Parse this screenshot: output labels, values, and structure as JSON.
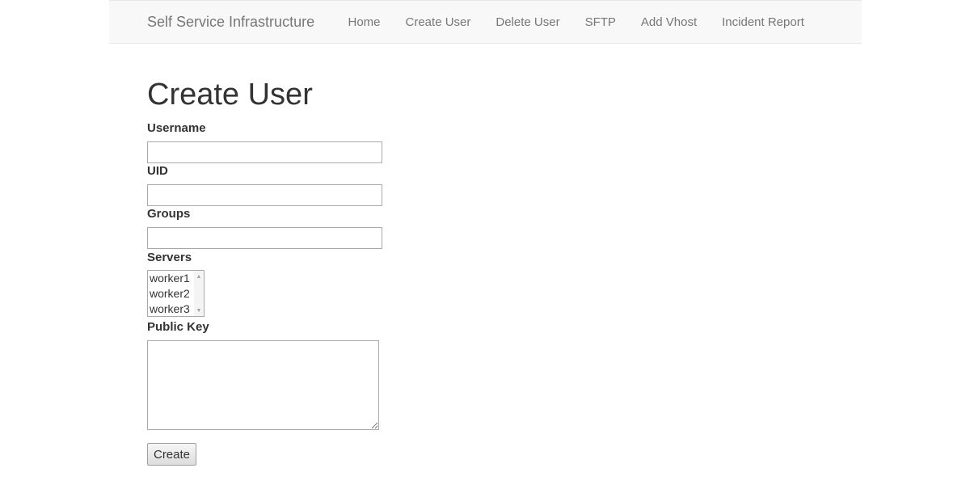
{
  "navbar": {
    "brand": "Self Service Infrastructure",
    "links": [
      {
        "label": "Home"
      },
      {
        "label": "Create User"
      },
      {
        "label": "Delete User"
      },
      {
        "label": "SFTP"
      },
      {
        "label": "Add Vhost"
      },
      {
        "label": "Incident Report"
      }
    ]
  },
  "form": {
    "title": "Create User",
    "username": {
      "label": "Username",
      "value": ""
    },
    "uid": {
      "label": "UID",
      "value": ""
    },
    "groups": {
      "label": "Groups",
      "value": ""
    },
    "servers": {
      "label": "Servers",
      "options": [
        "worker1",
        "worker2",
        "worker3"
      ]
    },
    "public_key": {
      "label": "Public Key",
      "value": ""
    },
    "submit_label": "Create"
  }
}
